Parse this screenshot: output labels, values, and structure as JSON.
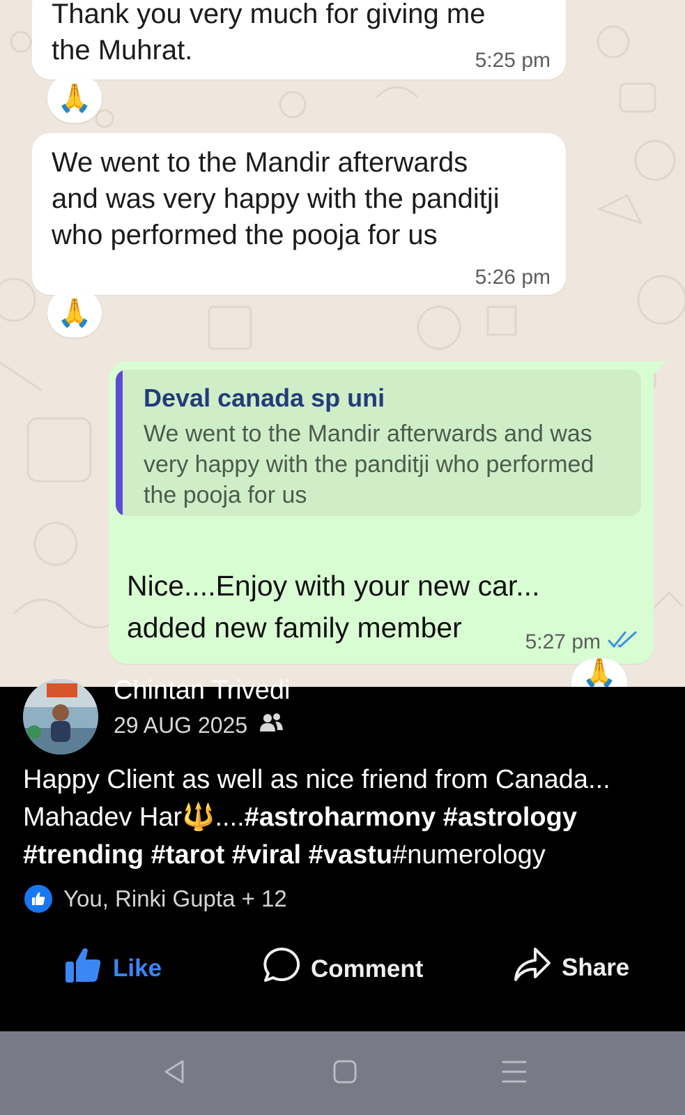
{
  "chat": {
    "messages": [
      {
        "text": "Thank you very much for giving me\nthe Muhrat.",
        "time": "5:25 pm",
        "reaction": "🙏"
      },
      {
        "text": "We went to the Mandir afterwards\nand was very happy with the panditji\nwho performed the pooja for us",
        "time": "5:26 pm",
        "reaction": "🙏"
      }
    ],
    "reply": {
      "quoted_author": "Deval canada sp uni",
      "quoted_text": "We went to the Mandir afterwards and was very happy with the panditji who performed the pooja for us",
      "text": "Nice....Enjoy with your new car...\nadded new family member",
      "time": "5:27 pm",
      "reaction": "🙏",
      "status": "read"
    }
  },
  "post": {
    "author": "Chintan Trivedi",
    "date": "29 AUG 2025",
    "audience_icon": "friends-icon",
    "text_line1": "Happy Client as well as nice friend from Canada...",
    "text_line2_prefix": "Mahadev Har",
    "trident": "🔱",
    "ellipsis": "....",
    "hashtags_line2": "#astroharmony #astrology",
    "hashtags_line3_bold": "#trending #tarot #viral #vastu",
    "hashtag_plain": "#numerology",
    "reactions_summary": "You, Rinki Gupta + 12",
    "actions": {
      "like": "Like",
      "comment": "Comment",
      "share": "Share"
    },
    "colors": {
      "like_blue": "#3b87f5",
      "background": "#000000"
    }
  },
  "nav_bar": {
    "buttons": [
      "back-icon",
      "home-icon",
      "recents-icon"
    ]
  }
}
